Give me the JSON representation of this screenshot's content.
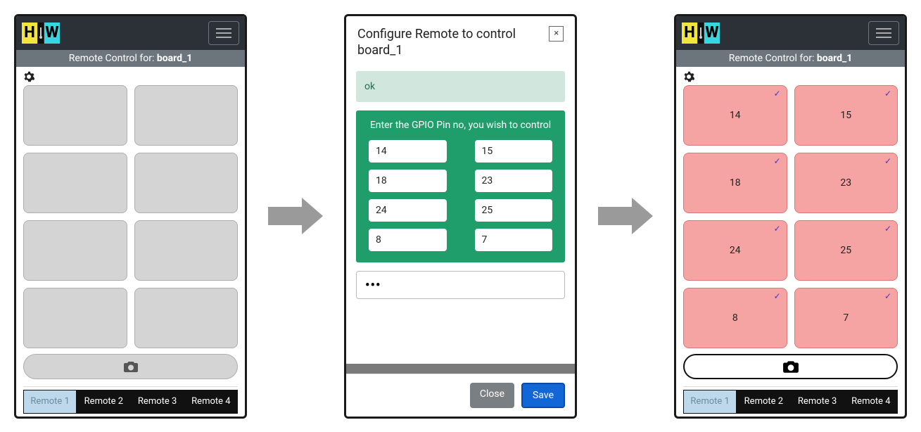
{
  "screen1": {
    "subheader_prefix": "Remote Control for: ",
    "subheader_board": "board_1",
    "tabs": [
      "Remote 1",
      "Remote 2",
      "Remote 3",
      "Remote 4"
    ]
  },
  "modal": {
    "title": "Configure Remote to control board_1",
    "status": "ok",
    "instruction": "Enter the GPIO Pin no, you wish to control",
    "pins": [
      "14",
      "15",
      "18",
      "23",
      "24",
      "25",
      "8",
      "7"
    ],
    "dots": "•••",
    "close_label": "Close",
    "save_label": "Save"
  },
  "screen3": {
    "subheader_prefix": "Remote Control for: ",
    "subheader_board": "board_1",
    "buttons": [
      "14",
      "15",
      "18",
      "23",
      "24",
      "25",
      "8",
      "7"
    ],
    "tabs": [
      "Remote 1",
      "Remote 2",
      "Remote 3",
      "Remote 4"
    ]
  }
}
